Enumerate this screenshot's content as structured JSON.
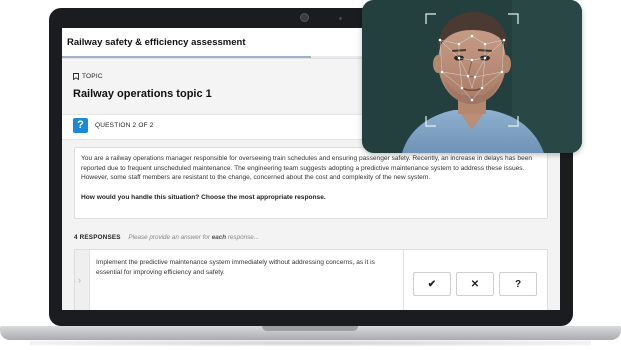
{
  "app": {
    "title": "Railway safety & efficiency assessment",
    "progress": 0.5
  },
  "topic": {
    "label": "TOPIC",
    "icon": "bookmark-icon",
    "title": "Railway operations topic 1"
  },
  "question": {
    "badge": "?",
    "counter": "QUESTION 2 OF 2",
    "scenario": "You are a railway operations manager responsible for overseeing train schedules and ensuring passenger safety. Recently, an increase in delays has been reported due to frequent unscheduled maintenance. The engineering team suggests adopting a predictive maintenance system to address these issues. However, some staff members are resistant to the change, concerned about the cost and complexity of the new system.",
    "prompt": "How would you handle this situation? Choose the most appropriate response."
  },
  "responses": {
    "count_label": "4 RESPONSES",
    "hint_prefix": "Please provide an answer for ",
    "hint_emph": "each",
    "hint_suffix": " response...",
    "items": [
      {
        "text": "Implement the predictive maintenance system immediately without addressing concerns, as it is essential for improving efficiency and safety.",
        "buttons": [
          {
            "symbol": "✔",
            "icon": "check-icon"
          },
          {
            "symbol": "✕",
            "icon": "close-icon"
          },
          {
            "symbol": "?",
            "icon": "question-icon"
          }
        ]
      }
    ]
  },
  "colors": {
    "accent": "#1b88d8",
    "laptop_body": "#1b1c1f",
    "screen_bg": "#f3f3f3"
  }
}
